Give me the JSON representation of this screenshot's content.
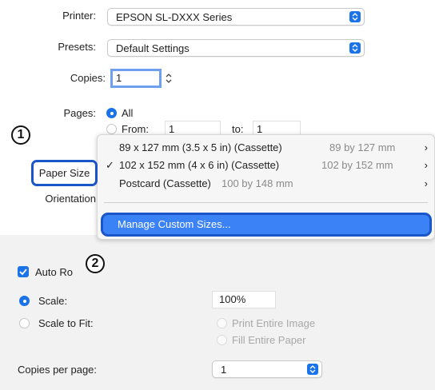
{
  "printer": {
    "label": "Printer:",
    "value": "EPSON SL-DXXX Series"
  },
  "presets": {
    "label": "Presets:",
    "value": "Default Settings"
  },
  "copies": {
    "label": "Copies:",
    "value": "1"
  },
  "pages": {
    "label": "Pages:",
    "all_label": "All",
    "from_label": "From:",
    "from_value": "1",
    "to_label": "to:",
    "to_value": "1"
  },
  "paper_size_label": "Paper Size",
  "orientation_label": "Orientation",
  "paper_menu": {
    "items": [
      {
        "main": "89 x 127 mm (3.5 x 5 in) (Cassette)",
        "dim": "89 by 127 mm",
        "checked": false
      },
      {
        "main": "102 x 152 mm (4 x 6 in) (Cassette)",
        "dim": "102 by 152 mm",
        "checked": true
      },
      {
        "main": "Postcard (Cassette)",
        "dim": "100 by 148 mm",
        "checked": false
      }
    ],
    "manage_label": "Manage Custom Sizes..."
  },
  "callouts": {
    "one": "1",
    "two": "2"
  },
  "auto_rotate_label": "Auto Ro",
  "scale": {
    "label": "Scale:",
    "value": "100%"
  },
  "scale_to_fit": {
    "label": "Scale to Fit:",
    "print_entire": "Print Entire Image",
    "fill_entire": "Fill Entire Paper"
  },
  "copies_per_page": {
    "label": "Copies per page:",
    "value": "1"
  },
  "colors": {
    "accent": "#1a73e8",
    "callout_border": "#1a56c8"
  }
}
